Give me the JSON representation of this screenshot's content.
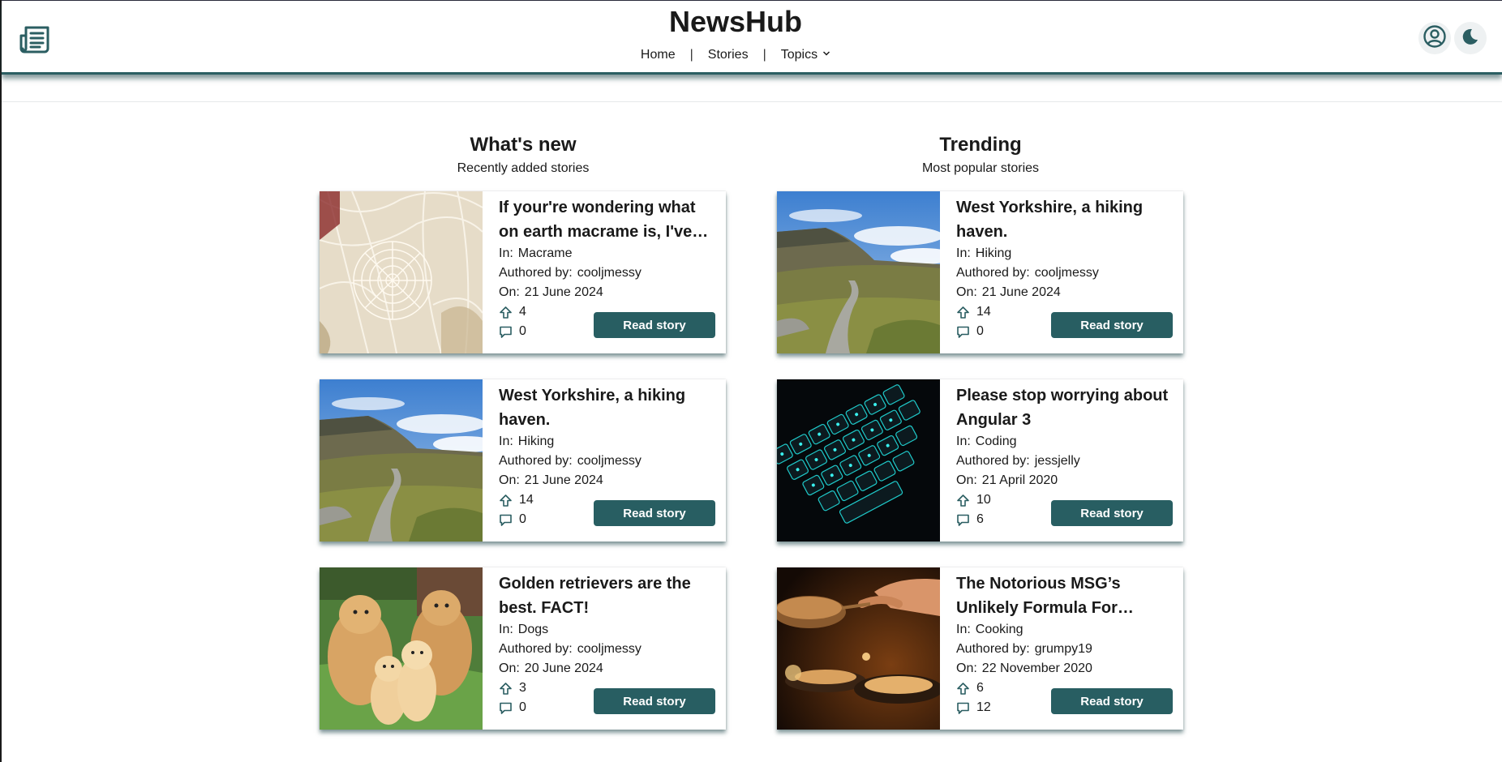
{
  "header": {
    "site_title": "NewsHub",
    "nav": [
      {
        "label": "Home"
      },
      {
        "label": "Stories"
      },
      {
        "label": "Topics"
      }
    ],
    "separator": "|",
    "icons": {
      "logo": "newspaper-icon",
      "account": "user-circle-icon",
      "theme": "moon-icon",
      "topics_dropdown": "chevron-down-icon"
    }
  },
  "colors": {
    "accent": "#285e62",
    "text": "#1a1a1a",
    "icon": "#2b5e62"
  },
  "labels": {
    "in": "In:",
    "authored_by": "Authored by:",
    "on": "On:",
    "read": "Read story"
  },
  "sections": {
    "whats_new": {
      "title": "What's new",
      "subtitle": "Recently added stories",
      "stories": [
        {
          "title": "If your're wondering what on earth macrame is, I've…",
          "topic": "Macrame",
          "author": "cooljmessy",
          "date": "21 June 2024",
          "upvotes": "4",
          "comments": "0",
          "image": "macrame"
        },
        {
          "title": "West Yorkshire, a hiking haven.",
          "topic": "Hiking",
          "author": "cooljmessy",
          "date": "21 June 2024",
          "upvotes": "14",
          "comments": "0",
          "image": "hiking"
        },
        {
          "title": "Golden retrievers are the best. FACT!",
          "topic": "Dogs",
          "author": "cooljmessy",
          "date": "20 June 2024",
          "upvotes": "3",
          "comments": "0",
          "image": "dogs"
        }
      ]
    },
    "trending": {
      "title": "Trending",
      "subtitle": "Most popular stories",
      "stories": [
        {
          "title": "West Yorkshire, a hiking haven.",
          "topic": "Hiking",
          "author": "cooljmessy",
          "date": "21 June 2024",
          "upvotes": "14",
          "comments": "0",
          "image": "hiking"
        },
        {
          "title": "Please stop worrying about Angular 3",
          "topic": "Coding",
          "author": "jessjelly",
          "date": "21 April 2020",
          "upvotes": "10",
          "comments": "6",
          "image": "keyboard"
        },
        {
          "title": "The Notorious MSG’s Unlikely Formula For…",
          "topic": "Cooking",
          "author": "grumpy19",
          "date": "22 November 2020",
          "upvotes": "6",
          "comments": "12",
          "image": "cooking"
        }
      ]
    }
  }
}
